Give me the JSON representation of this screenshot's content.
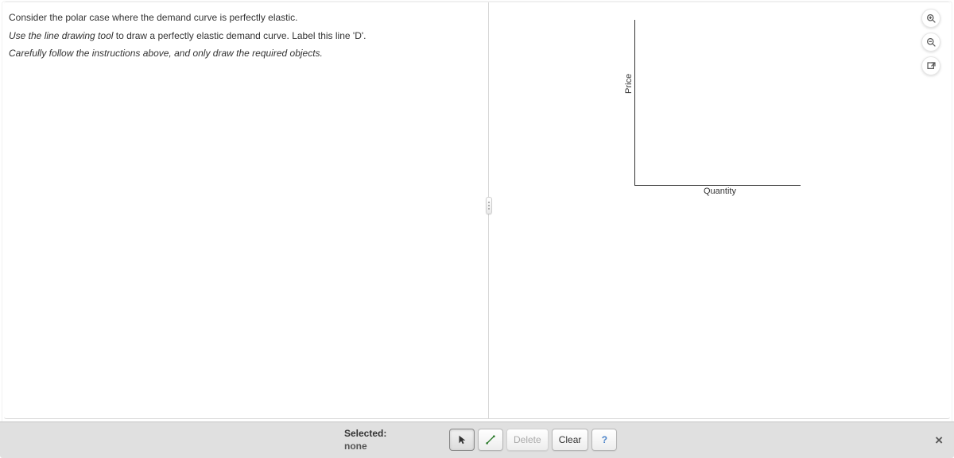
{
  "instructions": {
    "line1": "Consider the polar case where the demand curve is perfectly elastic.",
    "line2_prefix_italic": "Use the line drawing tool ",
    "line2_rest": "to draw a perfectly elastic demand curve. Label this line 'D'.",
    "line3_italic": "Carefully follow the instructions above, and only draw the required objects."
  },
  "chart": {
    "ylabel": "Price",
    "xlabel": "Quantity"
  },
  "right_tools": {
    "zoom_in": "zoom-in-icon",
    "zoom_out": "zoom-out-icon",
    "expand": "expand-icon"
  },
  "toolbar": {
    "selected_label": "Selected:",
    "selected_value": "none",
    "pointer": "pointer-tool",
    "line": "line-tool",
    "delete": "Delete",
    "clear": "Clear",
    "help": "?",
    "close": "×"
  },
  "chart_data": {
    "type": "line",
    "title": "",
    "xlabel": "Quantity",
    "ylabel": "Price",
    "xlim": [
      0,
      10
    ],
    "ylim": [
      0,
      10
    ],
    "series": []
  }
}
